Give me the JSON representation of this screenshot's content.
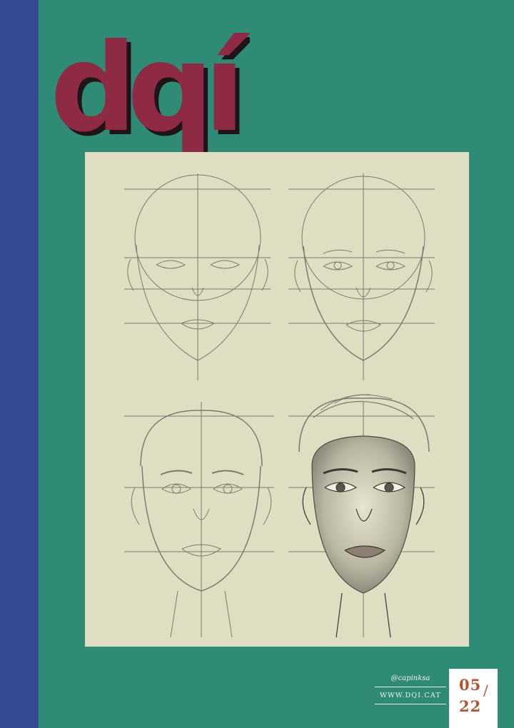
{
  "brand": {
    "logo_text": "dqí"
  },
  "colors": {
    "background": "#2f8b76",
    "spine": "#344a94",
    "logo": "#8f2a44",
    "logo_shadow": "#1f1418",
    "artboard": "#dfddc2",
    "issue_text": "#b25533"
  },
  "credits": {
    "handle": "@capinksa",
    "website": "WWW.DQI.CAT"
  },
  "issue": {
    "number": "05",
    "separator": "/",
    "year": "22"
  },
  "artwork": {
    "icon": "face-drawing-steps-icon"
  }
}
